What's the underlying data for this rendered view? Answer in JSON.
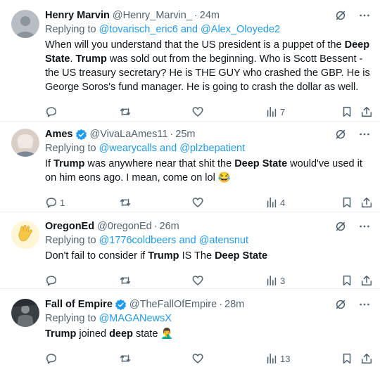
{
  "tweets": [
    {
      "name": "Henry Marvin",
      "verified": false,
      "handle": "@Henry_Marvin_",
      "dot": "·",
      "time": "24m",
      "replying_prefix": "Replying to ",
      "replying_to": "@tovarisch_eric6 and @Alex_Oloyede2",
      "segments": [
        {
          "t": "When will you understand that the US president is a puppet of the ",
          "b": false
        },
        {
          "t": "Deep State",
          "b": true
        },
        {
          "t": ". ",
          "b": false
        },
        {
          "t": "Trump",
          "b": true
        },
        {
          "t": " was sold out from the beginning. Who is Scott Bessent - the US treasury secretary? He is THE GUY who crashed the GBP. He is George Soros's fund manager. He is going to crash the dollar as well.",
          "b": false
        }
      ],
      "reply_count": "",
      "repost_count": "",
      "like_count": "",
      "view_count": "7"
    },
    {
      "name": "Ames",
      "verified": true,
      "handle": "@VivaLaAmes11",
      "dot": "·",
      "time": "25m",
      "replying_prefix": "Replying to ",
      "replying_to": "@wearycalls and @plzbepatient",
      "segments": [
        {
          "t": "If ",
          "b": false
        },
        {
          "t": "Trump",
          "b": true
        },
        {
          "t": " was anywhere near that shit the ",
          "b": false
        },
        {
          "t": "Deep State",
          "b": true
        },
        {
          "t": " would've used it on him eons ago. I mean, come on lol 😂",
          "b": false
        }
      ],
      "reply_count": "1",
      "repost_count": "",
      "like_count": "",
      "view_count": "4"
    },
    {
      "name": "OregonEd",
      "verified": false,
      "handle": "@0regonEd",
      "dot": "·",
      "time": "26m",
      "replying_prefix": "Replying to ",
      "replying_to": "@1776coldbeers and @atensnut",
      "segments": [
        {
          "t": "Don't fail to consider if ",
          "b": false
        },
        {
          "t": "Trump",
          "b": true
        },
        {
          "t": " IS The ",
          "b": false
        },
        {
          "t": "Deep State",
          "b": true
        }
      ],
      "reply_count": "",
      "repost_count": "",
      "like_count": "",
      "view_count": "3"
    },
    {
      "name": "Fall of Empire",
      "verified": true,
      "handle": "@TheFallOfEmpire",
      "dot": "·",
      "time": "28m",
      "replying_prefix": "Replying to ",
      "replying_to": "@MAGANewsX",
      "segments": [
        {
          "t": "Trump",
          "b": true
        },
        {
          "t": " joined ",
          "b": false
        },
        {
          "t": "deep",
          "b": true
        },
        {
          "t": " state 🤦‍♂️",
          "b": false
        }
      ],
      "reply_count": "",
      "repost_count": "",
      "like_count": "",
      "view_count": "13"
    }
  ],
  "icons": {
    "grok": "grok-icon",
    "more": "more-icon",
    "reply": "reply-icon",
    "repost": "repost-icon",
    "like": "like-icon",
    "views": "views-icon",
    "bookmark": "bookmark-icon",
    "share": "share-icon"
  },
  "colors": {
    "link": "#1d9bf0",
    "muted": "#536471",
    "verified": "#1d9bf0"
  }
}
